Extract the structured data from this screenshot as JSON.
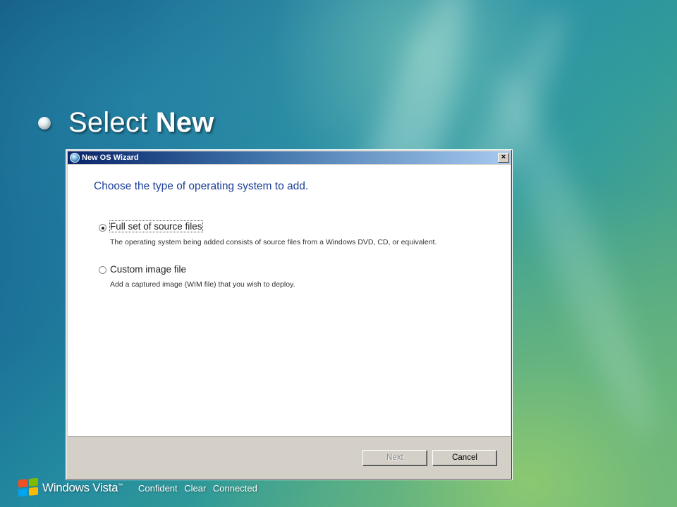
{
  "slide": {
    "title_prefix": "Select",
    "title_emphasis": "New"
  },
  "dialog": {
    "title": "New OS Wizard",
    "close_label": "×",
    "heading": "Choose the type of operating system to add.",
    "options": [
      {
        "label": "Full set of source files",
        "description": "The operating system being added consists of source files from a Windows DVD, CD, or equivalent.",
        "selected": true
      },
      {
        "label": "Custom image file",
        "description": "Add a captured image (WIM file) that you wish to deploy.",
        "selected": false
      }
    ],
    "buttons": {
      "next": "Next",
      "cancel": "Cancel"
    }
  },
  "branding": {
    "product": "Windows Vista",
    "trademark": "™",
    "tagline": "Confident Clear Connected"
  },
  "colors": {
    "heading": "#1c3f9a",
    "titlebar_start": "#0a246a",
    "titlebar_end": "#a6caf0",
    "dialog_face": "#d4d0c8"
  },
  "icons": [
    "bullet-icon",
    "wizard-icon",
    "close-icon",
    "windows-flag-icon"
  ]
}
